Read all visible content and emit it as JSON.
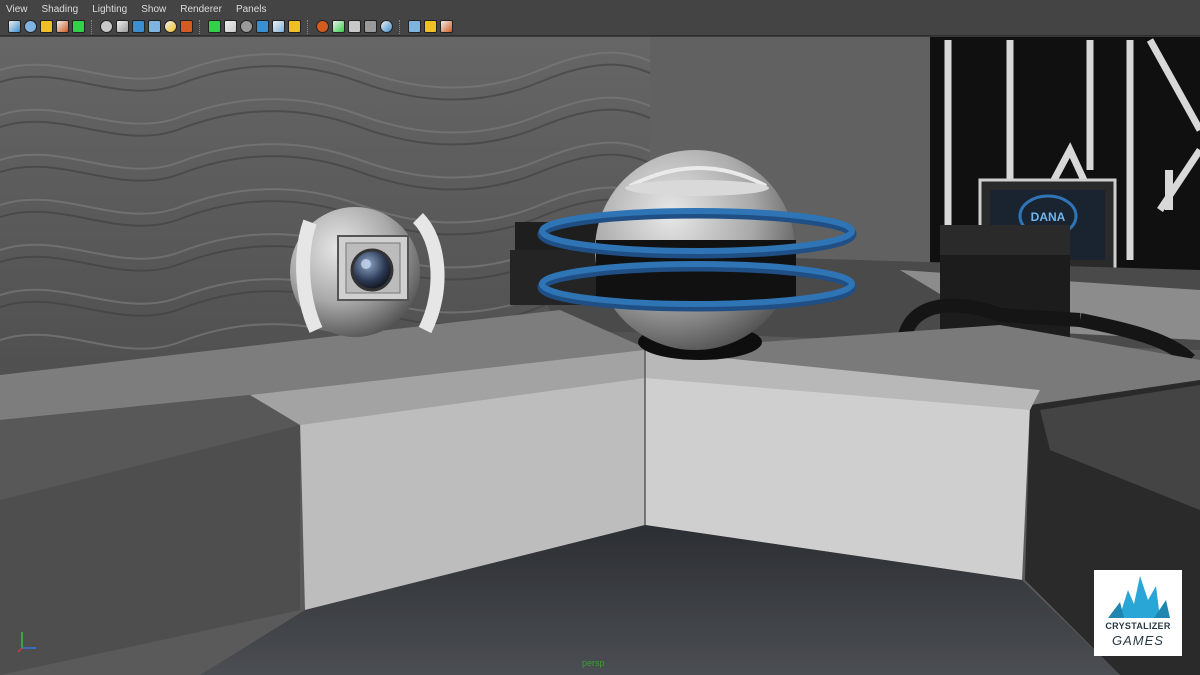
{
  "menu": {
    "items": [
      {
        "name": "menu-view",
        "label": "View"
      },
      {
        "name": "menu-shading",
        "label": "Shading"
      },
      {
        "name": "menu-lighting",
        "label": "Lighting"
      },
      {
        "name": "menu-show",
        "label": "Show"
      },
      {
        "name": "menu-renderer",
        "label": "Renderer"
      },
      {
        "name": "menu-panels",
        "label": "Panels"
      }
    ]
  },
  "toolbar": {
    "groups": [
      [
        "select-camera-icon",
        "camera-attributes-icon",
        "bookmarks-icon",
        "image-plane-icon",
        "grid-icon"
      ],
      [
        "film-gate-icon",
        "resolution-gate-icon",
        "gate-mask-icon",
        "field-chart-icon",
        "safe-action-icon",
        "safe-title-icon"
      ],
      [
        "wireframe-icon",
        "smooth-shade-icon",
        "wireframe-on-shaded-icon",
        "flat-shade-icon",
        "bounding-box-icon",
        "textured-icon"
      ],
      [
        "use-all-lights-icon",
        "shadows-icon",
        "ambient-occlusion-icon",
        "motion-blur-icon",
        "x-ray-icon"
      ],
      [
        "isolate-select-icon",
        "xray-joints-icon",
        "hud-icon"
      ]
    ],
    "colors": {
      "wireframe": "#3a8fd1",
      "smooth": "#7fb3e0",
      "light": "#f0c020",
      "render": "#d25b1f",
      "green": "#35d04a"
    }
  },
  "viewport": {
    "camera_label": "persp",
    "screen_text": "DANA",
    "accent_color": "#2f74b5"
  },
  "logo": {
    "line1": "CRYSTALIZER",
    "line2": "GAMES"
  }
}
